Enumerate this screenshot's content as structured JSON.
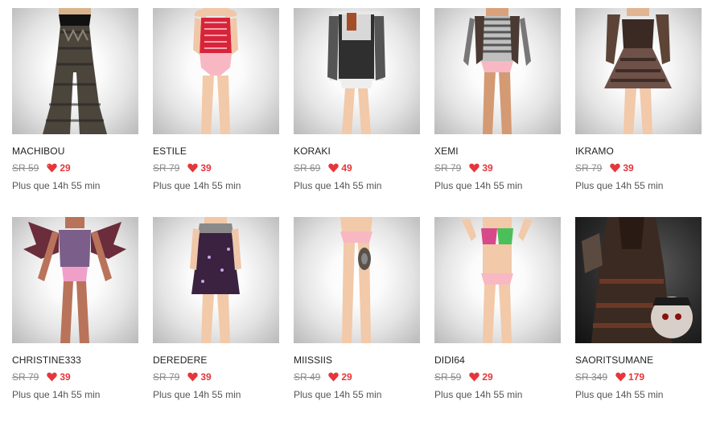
{
  "accent_color": "#e5363b",
  "timer_text": "Plus que 14h 55 min",
  "items": [
    {
      "name": "MACHIBOU",
      "old_price": "SR 59",
      "new_price": "29",
      "icon": "heart-icon"
    },
    {
      "name": "ESTILE",
      "old_price": "SR 79",
      "new_price": "39",
      "icon": "heart-icon"
    },
    {
      "name": "KORAKI",
      "old_price": "SR 69",
      "new_price": "49",
      "icon": "heart-icon"
    },
    {
      "name": "XEMI",
      "old_price": "SR 79",
      "new_price": "39",
      "icon": "heart-icon"
    },
    {
      "name": "IKRAMO",
      "old_price": "SR 79",
      "new_price": "39",
      "icon": "heart-icon"
    },
    {
      "name": "CHRISTINE333",
      "old_price": "SR 79",
      "new_price": "39",
      "icon": "heart-icon"
    },
    {
      "name": "DEREDERE",
      "old_price": "SR 79",
      "new_price": "39",
      "icon": "heart-icon"
    },
    {
      "name": "MIISSIIS",
      "old_price": "SR 49",
      "new_price": "29",
      "icon": "heart-icon"
    },
    {
      "name": "DIDI64",
      "old_price": "SR 59",
      "new_price": "29",
      "icon": "heart-icon"
    },
    {
      "name": "SAORITSUMANE",
      "old_price": "SR 349",
      "new_price": "179",
      "icon": "heart-icon"
    }
  ]
}
